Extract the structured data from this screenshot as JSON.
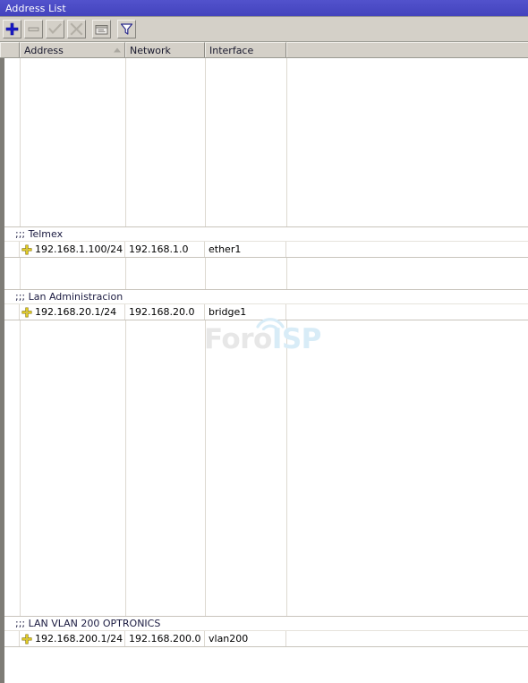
{
  "window": {
    "title": "Address List"
  },
  "toolbar": {
    "buttons": [
      {
        "name": "add-button",
        "icon": "plus-icon",
        "label": "Add",
        "enabled": true
      },
      {
        "name": "remove-button",
        "icon": "minus-icon",
        "label": "Remove",
        "enabled": false
      },
      {
        "name": "enable-button",
        "icon": "check-icon",
        "label": "Enable",
        "enabled": false
      },
      {
        "name": "disable-button",
        "icon": "cross-icon",
        "label": "Disable",
        "enabled": false
      },
      {
        "name": "comment-button",
        "icon": "comment-icon",
        "label": "Comment",
        "enabled": true
      },
      {
        "name": "filter-button",
        "icon": "funnel-icon",
        "label": "Filter",
        "enabled": true
      }
    ]
  },
  "table": {
    "columns": [
      {
        "key": "gutter",
        "label": ""
      },
      {
        "key": "address",
        "label": "Address",
        "sorted": "asc"
      },
      {
        "key": "network",
        "label": "Network"
      },
      {
        "key": "interface",
        "label": "Interface"
      },
      {
        "key": "rest",
        "label": ""
      }
    ],
    "groups": [
      {
        "comment": ";;; Telmex",
        "rows": [
          {
            "flag": "static-address-icon",
            "address": "192.168.1.100/24",
            "network": "192.168.1.0",
            "interface": "ether1"
          }
        ]
      },
      {
        "comment": ";;; Lan Administracion",
        "rows": [
          {
            "flag": "static-address-icon",
            "address": "192.168.20.1/24",
            "network": "192.168.20.0",
            "interface": "bridge1"
          }
        ]
      },
      {
        "comment": ";;; LAN VLAN 200 OPTRONICS",
        "rows": [
          {
            "flag": "static-address-icon",
            "address": "192.168.200.1/24",
            "network": "192.168.200.0",
            "interface": "vlan200"
          }
        ]
      }
    ]
  },
  "watermark": {
    "part1": "Foro",
    "part2": "ISP"
  },
  "colors": {
    "titlebar": "#4a4ac4",
    "toolbar": "#d4d0c8",
    "accent_flag": "#e8d21e",
    "watermark_foro": "#e7e7e7",
    "watermark_isp": "#d8ecf7"
  }
}
